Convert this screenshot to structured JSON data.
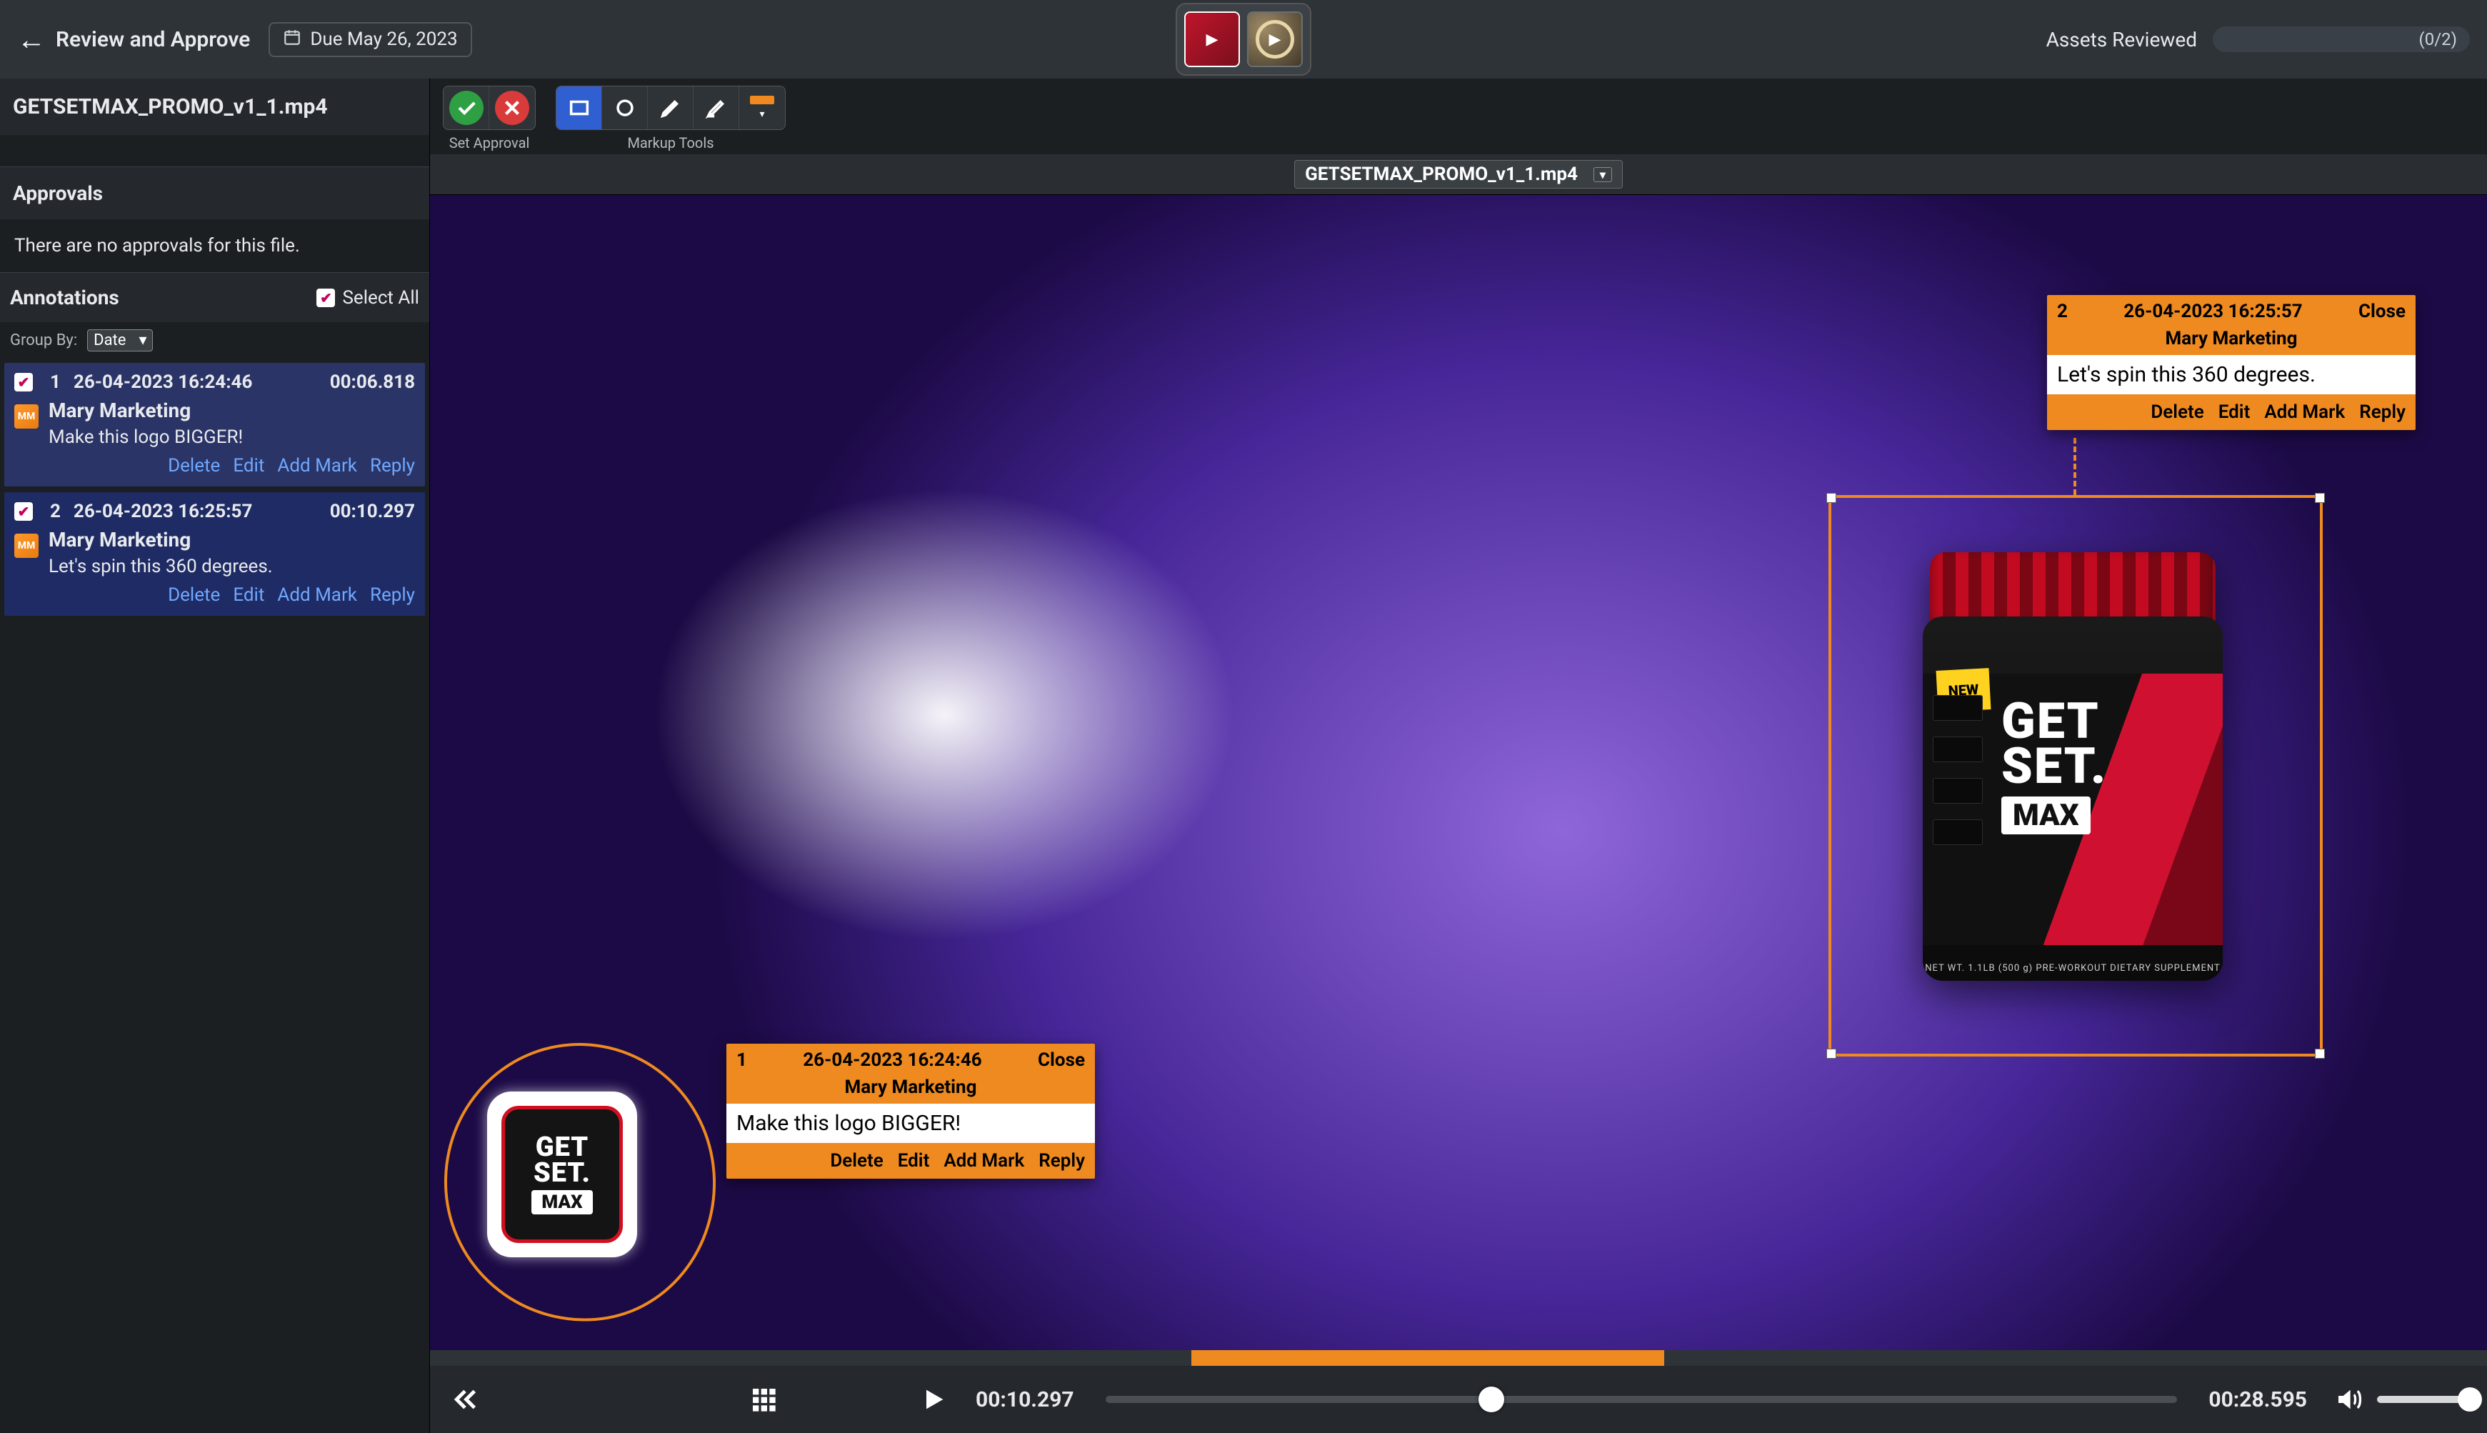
{
  "topbar": {
    "title": "Review and Approve",
    "due_label": "Due May 26, 2023",
    "assets_reviewed_label": "Assets Reviewed",
    "assets_reviewed_count": "(0/2)"
  },
  "sidebar": {
    "filename": "GETSETMAX_PROMO_v1_1.mp4",
    "approvals_header": "Approvals",
    "approvals_empty": "There are no approvals for this file.",
    "annotations_header": "Annotations",
    "select_all_label": "Select All",
    "group_by_label": "Group By:",
    "group_by_value": "Date",
    "items": [
      {
        "num": "1",
        "timestamp": "26-04-2023 16:24:46",
        "timecode": "00:06.818",
        "avatar": "MM",
        "user": "Mary Marketing",
        "text": "Make this logo BIGGER!",
        "actions": {
          "delete": "Delete",
          "edit": "Edit",
          "add_mark": "Add Mark",
          "reply": "Reply"
        }
      },
      {
        "num": "2",
        "timestamp": "26-04-2023 16:25:57",
        "timecode": "00:10.297",
        "avatar": "MM",
        "user": "Mary Marketing",
        "text": "Let's spin this 360 degrees.",
        "actions": {
          "delete": "Delete",
          "edit": "Edit",
          "add_mark": "Add Mark",
          "reply": "Reply"
        }
      }
    ]
  },
  "toolbar": {
    "set_approval_label": "Set Approval",
    "markup_tools_label": "Markup Tools"
  },
  "viewer": {
    "file_dropdown": "GETSETMAX_PROMO_v1_1.mp4",
    "logo_text_get": "GET",
    "logo_text_set": "SET.",
    "logo_text_max": "MAX",
    "jar_new": "NEW",
    "jar_foot": "NET WT. 1.1LB (500 g)  PRE-WORKOUT  DIETARY SUPPLEMENT"
  },
  "overlay_cards": [
    {
      "num": "1",
      "timestamp": "26-04-2023 16:24:46",
      "close": "Close",
      "user": "Mary Marketing",
      "message": "Make this logo BIGGER!",
      "actions": {
        "delete": "Delete",
        "edit": "Edit",
        "add_mark": "Add Mark",
        "reply": "Reply"
      }
    },
    {
      "num": "2",
      "timestamp": "26-04-2023 16:25:57",
      "close": "Close",
      "user": "Mary Marketing",
      "message": "Let's spin this 360 degrees.",
      "actions": {
        "delete": "Delete",
        "edit": "Edit",
        "add_mark": "Add Mark",
        "reply": "Reply"
      }
    }
  ],
  "transport": {
    "current": "00:10.297",
    "duration": "00:28.595",
    "scrub_percent": 36,
    "timeline_start_percent": 37,
    "timeline_end_percent": 60,
    "volume_percent": 100
  }
}
